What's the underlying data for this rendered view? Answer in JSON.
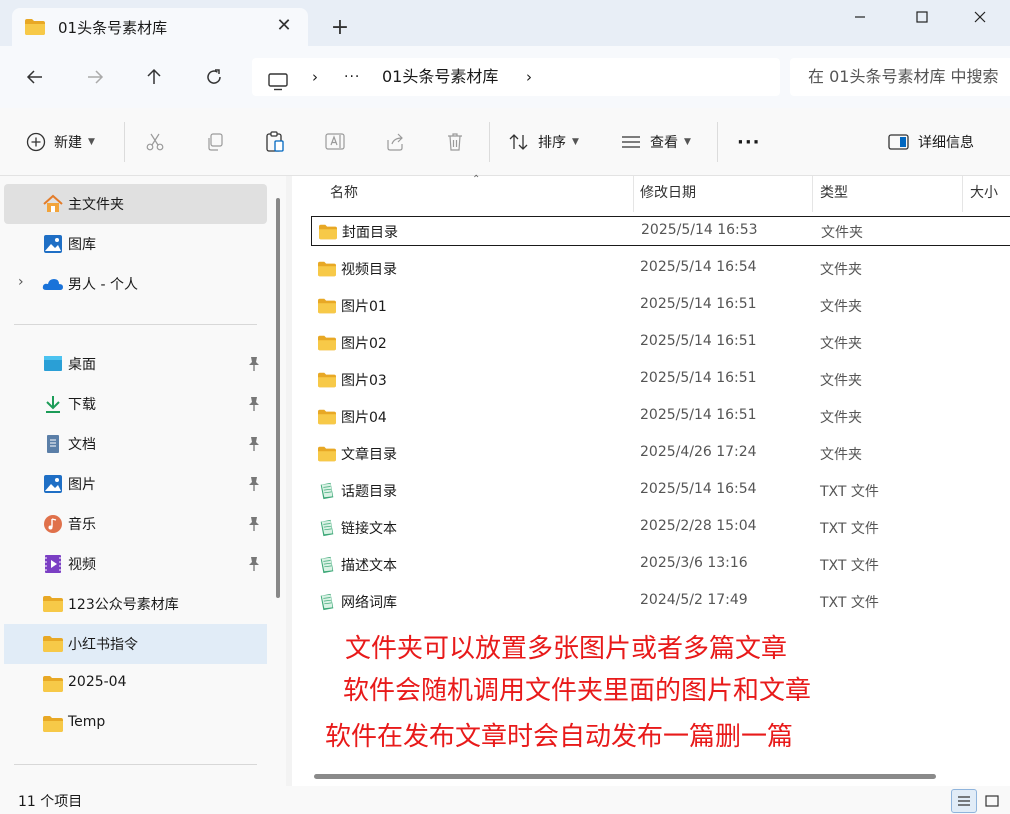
{
  "tab": {
    "title": "01头条号素材库",
    "close": "✕",
    "new_tab": "+"
  },
  "window": {
    "minimize": "—",
    "maximize": "□",
    "close": "✕"
  },
  "address": {
    "ellipsis": "···",
    "current": "01头条号素材库",
    "search_placeholder": "在 01头条号素材库 中搜索"
  },
  "toolbar": {
    "new_label": "新建",
    "sort_label": "排序",
    "view_label": "查看",
    "more": "···",
    "details_label": "详细信息"
  },
  "sidebar": {
    "items": [
      {
        "label": "主文件夹",
        "icon": "home-icon"
      },
      {
        "label": "图库",
        "icon": "gallery-icon"
      },
      {
        "label": "男人 - 个人",
        "icon": "onedrive-icon"
      },
      {
        "label": "桌面",
        "icon": "desktop-icon"
      },
      {
        "label": "下载",
        "icon": "download-icon"
      },
      {
        "label": "文档",
        "icon": "documents-icon"
      },
      {
        "label": "图片",
        "icon": "pictures-icon"
      },
      {
        "label": "音乐",
        "icon": "music-icon"
      },
      {
        "label": "视频",
        "icon": "videos-icon"
      },
      {
        "label": "123公众号素材库",
        "icon": "folder-icon"
      },
      {
        "label": "小红书指令",
        "icon": "folder-icon"
      },
      {
        "label": "2025-04",
        "icon": "folder-icon"
      },
      {
        "label": "Temp",
        "icon": "folder-icon"
      }
    ]
  },
  "columns": {
    "name": "名称",
    "date": "修改日期",
    "type": "类型",
    "size": "大小"
  },
  "files": [
    {
      "name": "封面目录",
      "date": "2025/5/14 16:53",
      "type": "文件夹",
      "kind": "folder"
    },
    {
      "name": "视频目录",
      "date": "2025/5/14 16:54",
      "type": "文件夹",
      "kind": "folder"
    },
    {
      "name": "图片01",
      "date": "2025/5/14 16:51",
      "type": "文件夹",
      "kind": "folder"
    },
    {
      "name": "图片02",
      "date": "2025/5/14 16:51",
      "type": "文件夹",
      "kind": "folder"
    },
    {
      "name": "图片03",
      "date": "2025/5/14 16:51",
      "type": "文件夹",
      "kind": "folder"
    },
    {
      "name": "图片04",
      "date": "2025/5/14 16:51",
      "type": "文件夹",
      "kind": "folder"
    },
    {
      "name": "文章目录",
      "date": "2025/4/26 17:24",
      "type": "文件夹",
      "kind": "folder"
    },
    {
      "name": "话题目录",
      "date": "2025/5/14 16:54",
      "type": "TXT 文件",
      "kind": "txt"
    },
    {
      "name": "链接文本",
      "date": "2025/2/28 15:04",
      "type": "TXT 文件",
      "kind": "txt"
    },
    {
      "name": "描述文本",
      "date": "2025/3/6 13:16",
      "type": "TXT 文件",
      "kind": "txt"
    },
    {
      "name": "网络词库",
      "date": "2024/5/2 17:49",
      "type": "TXT 文件",
      "kind": "txt"
    }
  ],
  "annotations": [
    "文件夹可以放置多张图片或者多篇文章",
    "软件会随机调用文件夹里面的图片和文章",
    "软件在发布文章时会自动发布一篇删一篇"
  ],
  "status": {
    "count": "11 个项目"
  },
  "colors": {
    "annotation": "#e81a1a",
    "folder": "#f4c542",
    "accent": "#0067c0"
  }
}
